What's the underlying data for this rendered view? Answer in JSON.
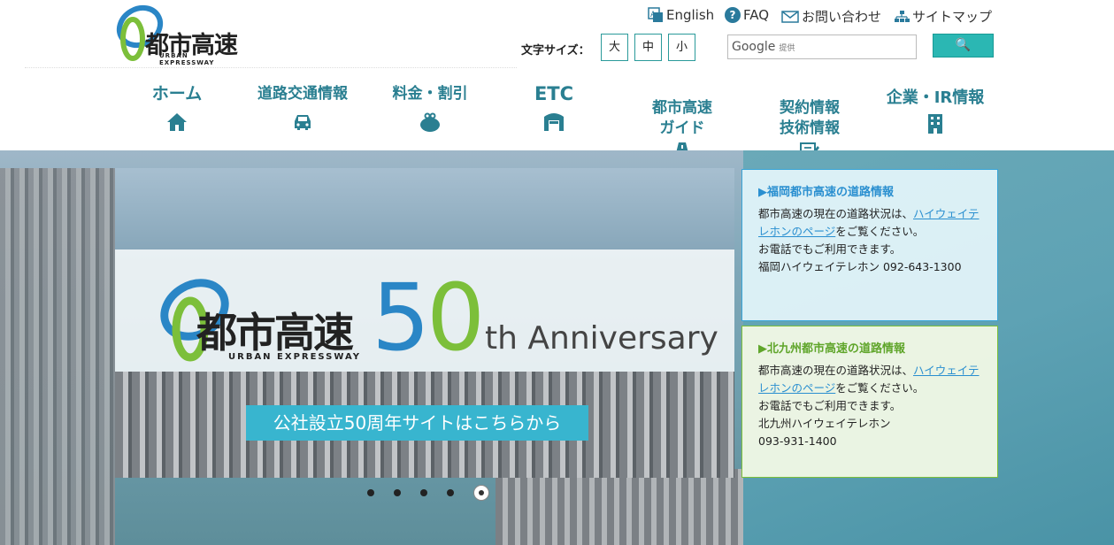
{
  "logo": {
    "jp": "都市高速",
    "en": "URBAN EXPRESSWAY"
  },
  "util_links": [
    {
      "label": "English"
    },
    {
      "label": "FAQ"
    },
    {
      "label": "お問い合わせ"
    },
    {
      "label": "サイトマップ"
    }
  ],
  "font_size": {
    "label": "文字サイズ：",
    "large": "大",
    "medium": "中",
    "small": "小"
  },
  "search": {
    "google": "Google",
    "provided": "提供",
    "button": "🔍"
  },
  "nav": [
    {
      "label": "ホーム",
      "icon": "home-icon"
    },
    {
      "label": "道路交通情報",
      "icon": "car-icon"
    },
    {
      "label": "料金・割引",
      "icon": "purse-icon"
    },
    {
      "label": "ETC",
      "icon": "etc-gate-icon"
    },
    {
      "label": "都市高速\nガイド",
      "icon": "road-icon"
    },
    {
      "label": "契約情報\n技術情報",
      "icon": "document-pen-icon"
    },
    {
      "label": "企業・IR情報",
      "icon": "building-icon"
    }
  ],
  "slide": {
    "jp": "都市高速",
    "en": "URBAN EXPRESSWAY",
    "num5": "5",
    "num0": "0",
    "anniversary": "th Anniversary",
    "cta": "公社設立50周年サイトはこちらから"
  },
  "fukuoka": {
    "title": "福岡都市高速の道路情報",
    "text1": "都市高速の現在の道路状況は、",
    "link": "ハイウェイテレホンのページ",
    "text2": "をご覧ください。",
    "text3": "お電話でもご利用できます。",
    "text4": "福岡ハイウェイテレホン 092-643-1300"
  },
  "kitakyushu": {
    "title": "北九州都市高速の道路情報",
    "text1": "都市高速の現在の道路状況は、",
    "link": "ハイウェイテレホンのページ",
    "text2": "をご覧ください。",
    "text3": "お電話でもご利用できます。",
    "text4": "北九州ハイウェイテレホン",
    "text5": "093-931-1400"
  },
  "colors": {
    "nav_text": "#2a7f91",
    "blue": "#2a86c6",
    "green": "#7cbf3a",
    "cta": "#38b5cf",
    "search_btn": "#2bb7b3"
  }
}
